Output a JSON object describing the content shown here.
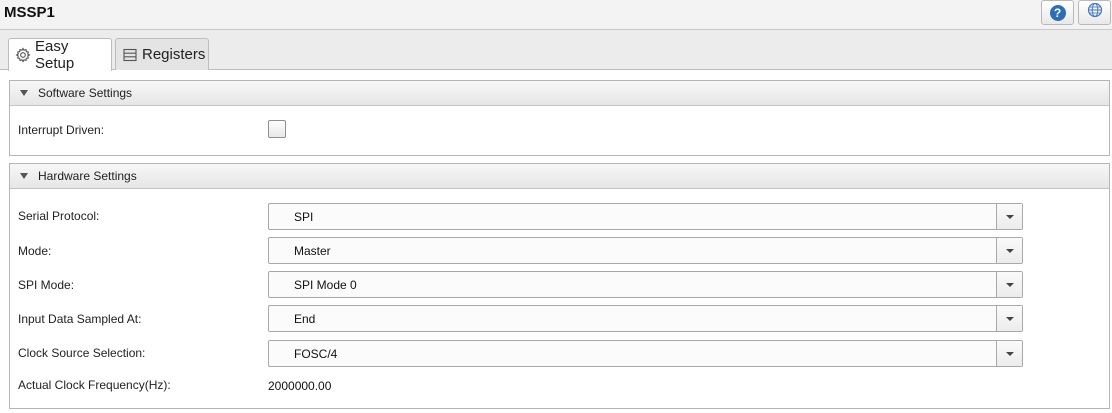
{
  "title": "MSSP1",
  "toolbar": {
    "help_icon": "help-icon",
    "help_glyph": "?",
    "web_icon": "globe-icon"
  },
  "tabs": [
    {
      "label": "Easy Setup",
      "icon": "gear-icon",
      "active": true
    },
    {
      "label": "Registers",
      "icon": "registers-icon",
      "active": false
    }
  ],
  "software_settings": {
    "heading": "Software Settings",
    "interrupt_driven": {
      "label": "Interrupt Driven:",
      "checked": false
    }
  },
  "hardware_settings": {
    "heading": "Hardware Settings",
    "serial_protocol": {
      "label": "Serial Protocol:",
      "value": "SPI"
    },
    "mode": {
      "label": "Mode:",
      "value": "Master"
    },
    "spi_mode": {
      "label": "SPI Mode:",
      "value": "SPI Mode 0"
    },
    "input_sampled": {
      "label": "Input Data Sampled At:",
      "value": "End"
    },
    "clock_source": {
      "label": "Clock Source Selection:",
      "value": "FOSC/4"
    },
    "actual_clock": {
      "label": "Actual Clock Frequency(Hz):",
      "value": "2000000.00"
    }
  },
  "colors": {
    "accent": "#2f6db5",
    "panel_border": "#b5b5b5",
    "header_bg": "#e6e6e6"
  }
}
